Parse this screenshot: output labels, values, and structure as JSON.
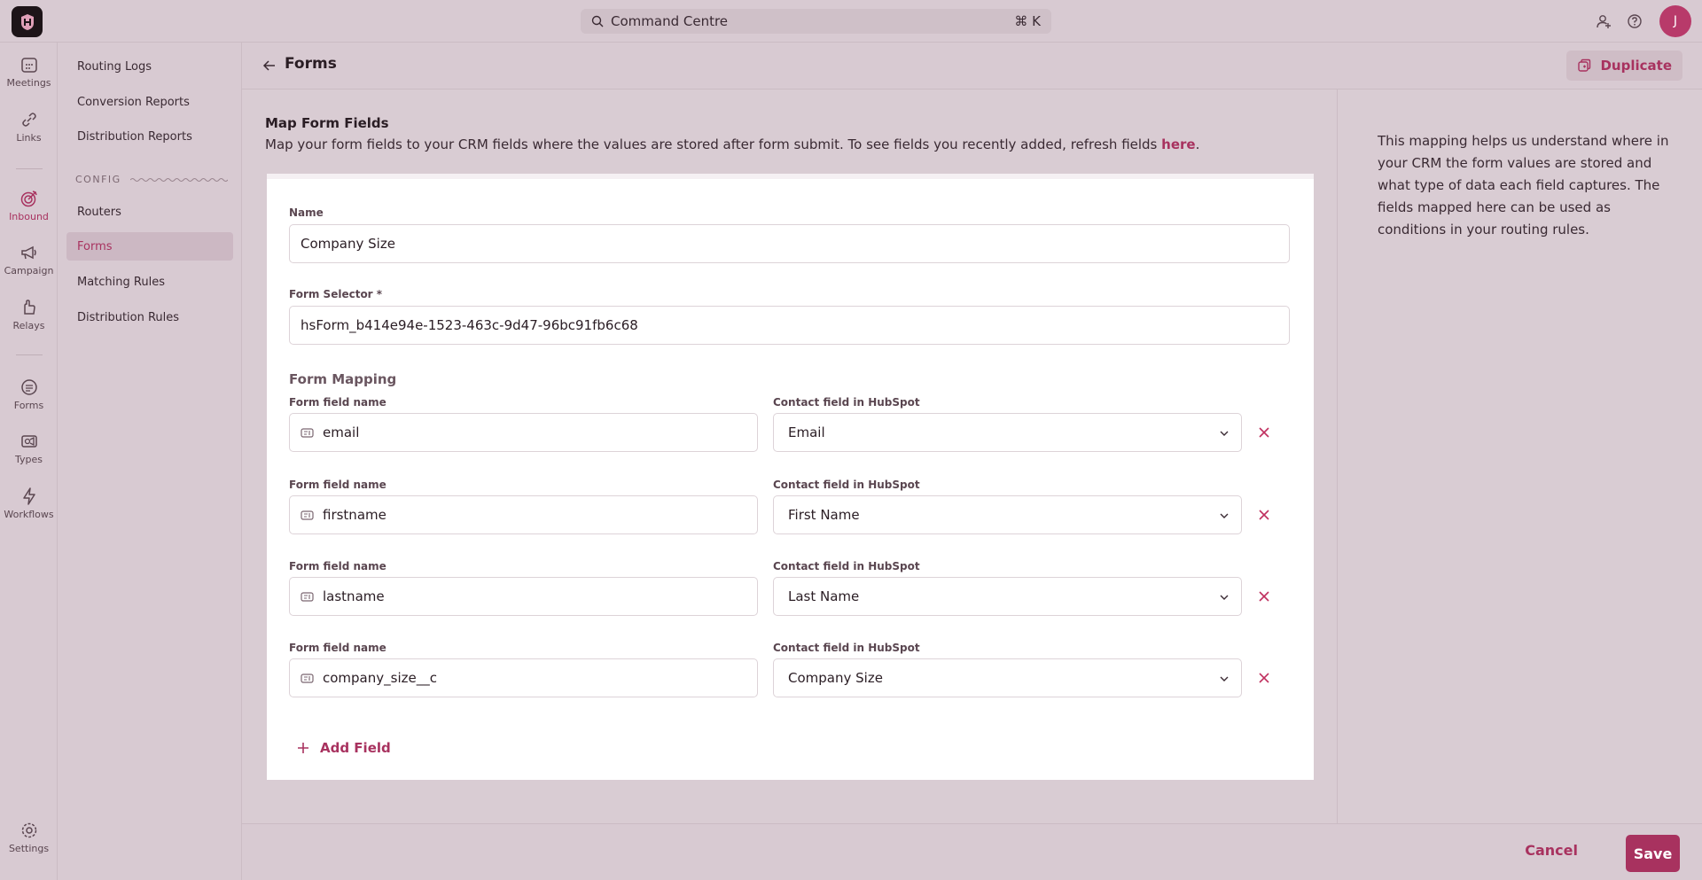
{
  "topbar": {
    "command_placeholder": "Command Centre",
    "command_shortcut": "⌘ K",
    "avatar_initial": "J"
  },
  "rail": {
    "items": [
      {
        "label": "Meetings",
        "icon": "calendar-icon"
      },
      {
        "label": "Links",
        "icon": "link-icon"
      },
      {
        "label": "Inbound",
        "icon": "target-icon",
        "active": true
      },
      {
        "label": "Campaign",
        "icon": "megaphone-icon"
      },
      {
        "label": "Relays",
        "icon": "hand-icon"
      },
      {
        "label": "Forms",
        "icon": "form-icon"
      },
      {
        "label": "Types",
        "icon": "video-icon"
      },
      {
        "label": "Workflows",
        "icon": "bolt-icon"
      },
      {
        "label": "Settings",
        "icon": "gear-icon"
      }
    ]
  },
  "subnav": {
    "items": [
      "Routing Logs",
      "Conversion Reports",
      "Distribution Reports"
    ],
    "config_label": "CONFIG",
    "config_items": [
      "Routers",
      "Forms",
      "Matching Rules",
      "Distribution Rules"
    ],
    "active": "Forms"
  },
  "header": {
    "title": "Forms",
    "duplicate_label": "Duplicate"
  },
  "section": {
    "title": "Map Form Fields",
    "description": "Map your form fields to your CRM fields where the values are stored after form submit. To see fields you recently added, refresh fields ",
    "link_text": "here",
    "period": "."
  },
  "form": {
    "name_label": "Name",
    "name_value": "Company Size",
    "selector_label": "Form Selector *",
    "selector_value": "hsForm_b414e94e-1523-463c-9d47-96bc91fb6c68",
    "mapping_title": "Form Mapping",
    "field_label": "Form field name",
    "crm_label": "Contact field in HubSpot",
    "rows": [
      {
        "field": "email",
        "crm": "Email"
      },
      {
        "field": "firstname",
        "crm": "First Name"
      },
      {
        "field": "lastname",
        "crm": "Last Name"
      },
      {
        "field": "company_size__c",
        "crm": "Company Size"
      }
    ],
    "add_field_label": "Add Field"
  },
  "help": {
    "text": "This mapping helps us understand where in your CRM the form values are stored and what type of data each field captures. The fields mapped here can be used as conditions in your routing rules."
  },
  "footer": {
    "cancel_label": "Cancel",
    "save_label": "Save"
  },
  "colors": {
    "accent": "#a8325f",
    "background": "#d9ccd3",
    "card": "#ffffff"
  }
}
